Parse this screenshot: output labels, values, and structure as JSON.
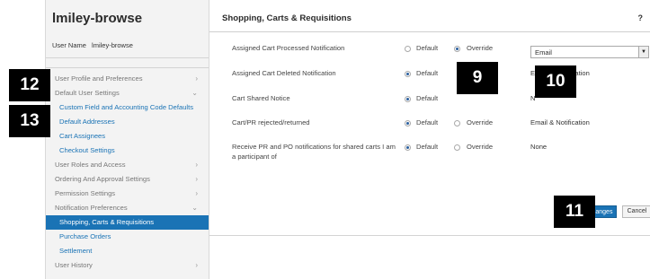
{
  "sidebar": {
    "title": "lmiley-browse",
    "user_label": "User Name",
    "user_value": "lmiley-browse",
    "items": [
      {
        "label": "User Profile and Preferences",
        "chevron": "›"
      },
      {
        "label": "Default User Settings",
        "chevron": "⌄"
      },
      {
        "label": "Custom Field and Accounting Code Defaults"
      },
      {
        "label": "Default Addresses"
      },
      {
        "label": "Cart Assignees"
      },
      {
        "label": "Checkout Settings"
      },
      {
        "label": "User Roles and Access",
        "chevron": "›"
      },
      {
        "label": "Ordering And Approval Settings",
        "chevron": "›"
      },
      {
        "label": "Permission Settings",
        "chevron": "›"
      },
      {
        "label": "Notification Preferences",
        "chevron": "⌄"
      },
      {
        "label": "Shopping, Carts & Requisitions"
      },
      {
        "label": "Purchase Orders"
      },
      {
        "label": "Settlement"
      },
      {
        "label": "User History",
        "chevron": "›"
      }
    ]
  },
  "main": {
    "title": "Shopping, Carts & Requisitions",
    "help": "?",
    "default_label": "Default",
    "override_label": "Override",
    "rows": [
      {
        "label": "Assigned Cart Processed Notification",
        "selected": "override",
        "select_value": "Email"
      },
      {
        "label": "Assigned Cart Deleted Notification",
        "selected": "default",
        "value": "Email & Notification"
      },
      {
        "label": "Cart Shared Notice",
        "selected": "default",
        "value": "N"
      },
      {
        "label": "Cart/PR rejected/returned",
        "selected": "default",
        "value": "Email & Notification"
      },
      {
        "label": "Receive PR and PO notifications for shared carts I am a participant of",
        "selected": "default",
        "value": "None"
      }
    ],
    "save_label": "Save Changes",
    "cancel_label": "Cancel"
  },
  "callouts": [
    "12",
    "13",
    "9",
    "10",
    "11"
  ],
  "colors": {
    "accent": "#1a73b5",
    "badge": "#000000"
  }
}
